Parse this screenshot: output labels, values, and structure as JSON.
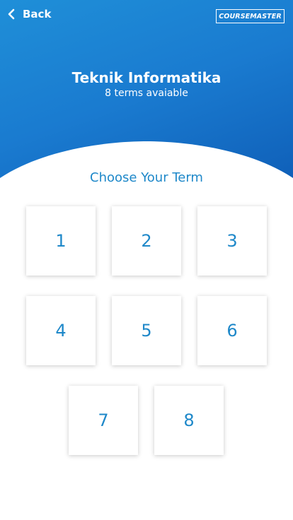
{
  "header": {
    "back_label": "Back",
    "logo_course": "COURSE",
    "logo_master": "MASTER",
    "title": "Teknik Informatika",
    "subtitle": "8 terms avaiable",
    "gradient_start": "#1f8fd8",
    "gradient_end": "#0f5fb8"
  },
  "main": {
    "heading": "Choose Your Term",
    "accent_color": "#1e88c9",
    "terms": [
      "1",
      "2",
      "3",
      "4",
      "5",
      "6",
      "7",
      "8"
    ]
  }
}
